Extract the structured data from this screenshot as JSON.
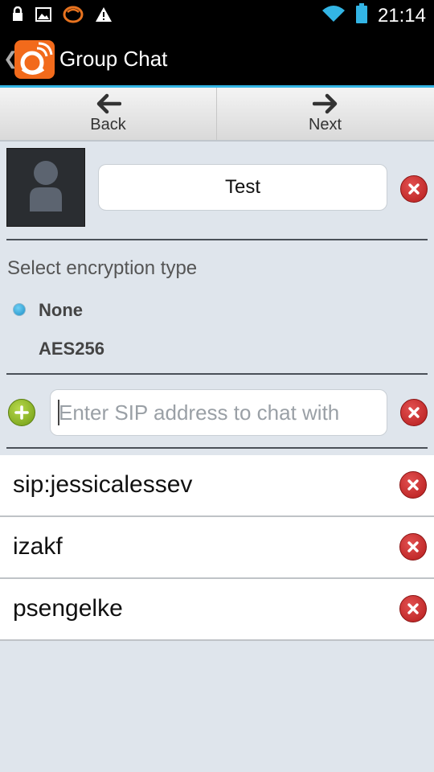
{
  "status_bar": {
    "time": "21:14",
    "left_icons": [
      "lock-icon",
      "image-icon",
      "app-notification-icon",
      "warning-icon"
    ],
    "right_icons": [
      "wifi-icon",
      "battery-icon"
    ]
  },
  "action_bar": {
    "title": "Group Chat",
    "up_glyph": "❮"
  },
  "toolbar": {
    "back_label": "Back",
    "next_label": "Next"
  },
  "group": {
    "name": "Test"
  },
  "encryption": {
    "label": "Select encryption type",
    "options": [
      {
        "label": "None",
        "selected": true
      },
      {
        "label": "AES256",
        "selected": false
      }
    ]
  },
  "sip_input": {
    "value": "",
    "placeholder": "Enter SIP address to chat with"
  },
  "participants": [
    {
      "name": "sip:jessicalessev"
    },
    {
      "name": "izakf"
    },
    {
      "name": "psengelke"
    }
  ],
  "colors": {
    "accent": "#33b5e5",
    "delete": "#c62828",
    "add": "#8cb82b",
    "background": "#dfe5ec"
  }
}
